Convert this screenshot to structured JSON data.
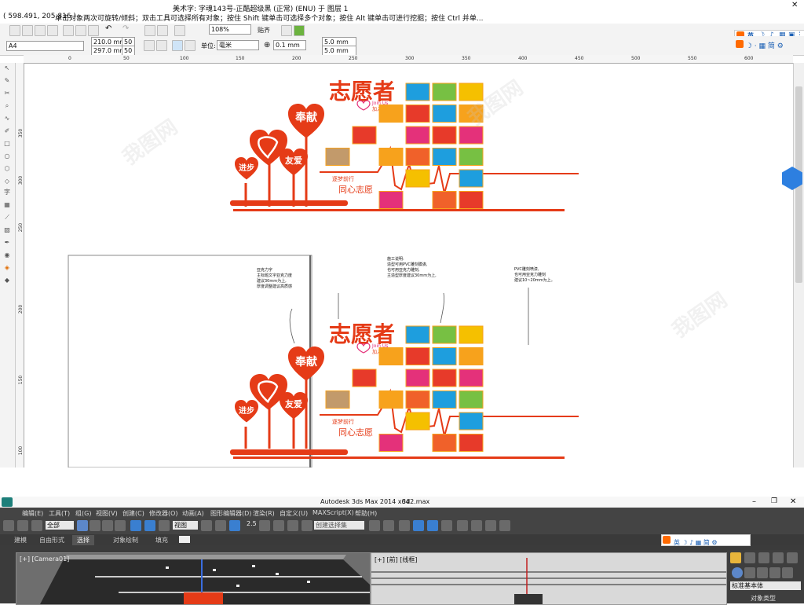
{
  "corel": {
    "title": "美术字: 字魂143号-正酷超级黑 (正常) (ENU) 于 图层 1",
    "coords": "( 598.491, 205.816 )",
    "hint": "单击对象两次可旋转/倾斜；双击工具可选择所有对象；按住 Shift 键单击可选择多个对象；按住 Alt 键单击可进行挖掘；按住 Ctrl 并单...",
    "zoom": "108%",
    "snap_label": "贴齐",
    "paper": "A4",
    "width": "210.0 mm",
    "height": "297.0 mm",
    "field_50a": "50",
    "field_50b": "50",
    "unit_label": "单位:",
    "unit_value": "毫米",
    "nudge": "0.1 mm",
    "dup_x": "5.0 mm",
    "dup_y": "5.0 mm",
    "ime": "英",
    "ruler_h": [
      "0",
      "50",
      "100",
      "150",
      "200",
      "250",
      "300",
      "350",
      "400",
      "450",
      "500",
      "550",
      "600"
    ],
    "ruler_v": [
      "350",
      "300",
      "250",
      "200",
      "150",
      "100"
    ],
    "toolbox_char": "字"
  },
  "design": {
    "title": "志愿者",
    "joinus": "Join Us",
    "joinus_cn": "加入我们吧!",
    "heart_big": "奉献",
    "heart_mid": "友爱",
    "heart_small": "进步",
    "slogan_small": "逐梦前行",
    "slogan_big": "同心志愿",
    "note1": [
      "亚克力字",
      "主标题文字亚克力度",
      "建议30mm为上,",
      "厚度调整建议高质感"
    ],
    "note2": [
      "施工说明:",
      "造型可用PVC雕刻膜诶,",
      "也可用亚克力雕刻,",
      "主造型厚度建议30mm为上,"
    ],
    "note3": [
      "PVC雕刻喷漆,",
      "也可用亚克力雕刻",
      "建议10~20mm为上。"
    ]
  },
  "max": {
    "title": "Autodesk 3ds Max  2014 x64",
    "file": "3d2.max",
    "menu": [
      "编辑(E)",
      "工具(T)",
      "组(G)",
      "视图(V)",
      "创建(C)",
      "修改器(O)",
      "动画(A)",
      "图形编辑器(D)",
      "渲染(R)",
      "自定义(U)",
      "MAXScript(X)",
      "帮助(H)"
    ],
    "filter": "全部",
    "coord": "视图",
    "snap_num": "2.5",
    "selection_set": "创建选择集",
    "ribbon": [
      "建模",
      "自由形式",
      "选择",
      "对象绘制",
      "填充"
    ],
    "vp1_label": "[+] [Camera01]",
    "vp2_label": "[+] [前] [线框]",
    "cmd_dropdown": "标准基本体",
    "cmd_section": "对象类型"
  },
  "palette": [
    "#f7a21c",
    "#77c043",
    "#f5c000",
    "#e73a2a",
    "#1e9ede",
    "#e4317a",
    "#2a7ab8",
    "#c29a6b",
    "#f0612a"
  ]
}
